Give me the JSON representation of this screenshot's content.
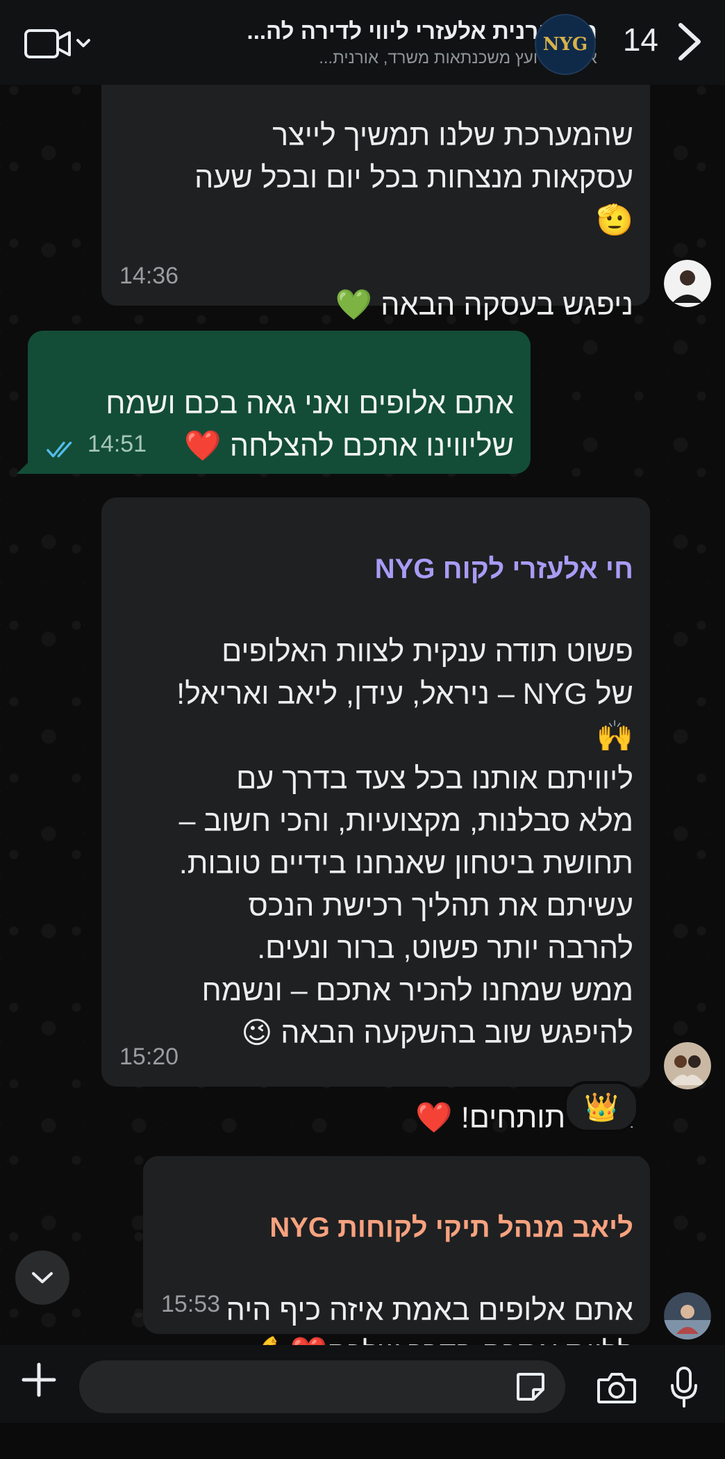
{
  "header": {
    "back_count": "14",
    "title": "חי ואורנית אלעזרי ליווי לדירה לה...",
    "subtitle": "אברהם יועץ משכנתאות משרד, אורנית...",
    "group_avatar_text": "NYG"
  },
  "messages": [
    {
      "text": "שהמערכת שלנו תמשיך לייצר\nעסקאות מנצחות בכל יום ובכל שעה\n🫡\n\nניפגש בעסקה הבאה 💚",
      "time": "14:36"
    },
    {
      "text": "אתם אלופים ואני גאה בכם ושמח\nשליווינו אתכם להצלחה ❤️",
      "time": "14:51"
    },
    {
      "sender": "חי אלעזרי לקוח NYG",
      "text": "פשוט תודה ענקית לצוות האלופים\nשל NYG – ניראל, עידן, ליאב ואריאל!\n🙌\nליוויתם אותנו בכל צעד בדרך עם\nמלא סבלנות, מקצועיות, והכי חשוב –\nתחושת ביטחון שאנחנו בידיים טובות.\nעשיתם את תהליך רכישת הנכס\nלהרבה יותר פשוט, ברור ונעים.\nממש שמחנו להכיר אתכם – ונשמח\nלהיפגש שוב בהשקעה הבאה 😉\n\nאתם תותחים! ❤️",
      "time": "15:20",
      "reaction": "👑"
    },
    {
      "sender": "ליאב מנהל תיקי לקוחות NYG",
      "text": "אתם אלופים באמת איזה כיף היה\nללוות אתכם בדרך שלכם❤️💪",
      "time": "15:53"
    }
  ],
  "colors": {
    "incoming_bubble": "#1f2022",
    "outgoing_bubble": "#134d37",
    "sender_purple": "#a99bf5",
    "sender_orange": "#f7a27f",
    "read_ticks": "#53bdeb"
  },
  "composer": {
    "placeholder": ""
  }
}
